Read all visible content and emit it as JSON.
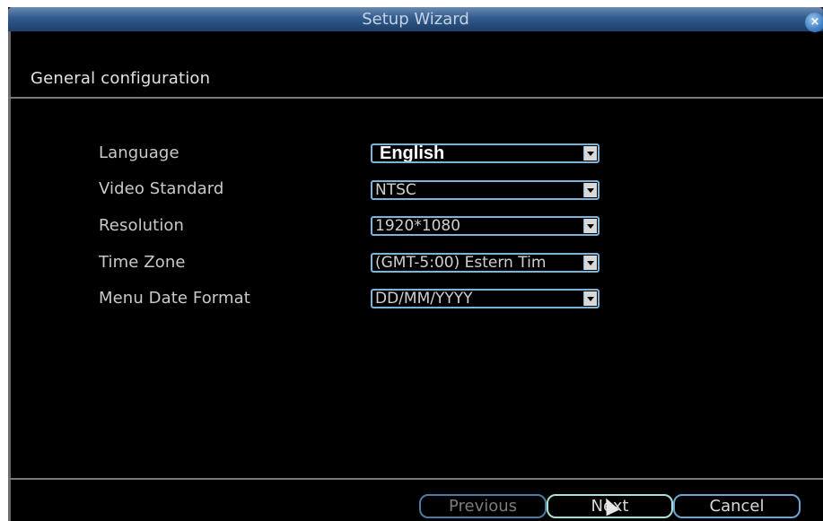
{
  "window": {
    "title": "Setup Wizard",
    "close_glyph": "×"
  },
  "section": {
    "title": "General configuration"
  },
  "fields": [
    {
      "label": "Language",
      "value": "English"
    },
    {
      "label": "Video Standard",
      "value": "NTSC"
    },
    {
      "label": "Resolution",
      "value": "1920*1080"
    },
    {
      "label": "Time Zone",
      "value": "(GMT-5:00) Estern Tim"
    },
    {
      "label": "Menu Date Format",
      "value": "DD/MM/YYYY"
    }
  ],
  "buttons": {
    "previous": "Previous",
    "next": "Next",
    "cancel": "Cancel"
  },
  "icons": {
    "close": "close-icon",
    "dropdown": "chevron-down-icon",
    "cursor": "mouse-pointer-icon"
  }
}
